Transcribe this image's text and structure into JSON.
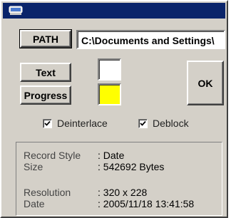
{
  "window": {
    "title_icon": "monitor-icon",
    "title_color": "#0a246a"
  },
  "path": {
    "button_label": "PATH",
    "value": "C:\\Documents and Settings\\"
  },
  "buttons": {
    "text_label": "Text",
    "progress_label": "Progress",
    "ok_label": "OK"
  },
  "colors": {
    "text_swatch": "#ffffff",
    "progress_swatch": "#ffff00"
  },
  "options": {
    "deinterlace": {
      "label": "Deinterlace",
      "checked": true
    },
    "deblock": {
      "label": "Deblock",
      "checked": true
    }
  },
  "info": {
    "record_style": {
      "label": "Record Style",
      "value": ": Date"
    },
    "size": {
      "label": "Size",
      "value": ": 542692 Bytes"
    },
    "resolution": {
      "label": "Resolution",
      "value": ": 320 x 228"
    },
    "date": {
      "label": "Date",
      "value": ": 2005/11/18  13:41:58"
    }
  }
}
